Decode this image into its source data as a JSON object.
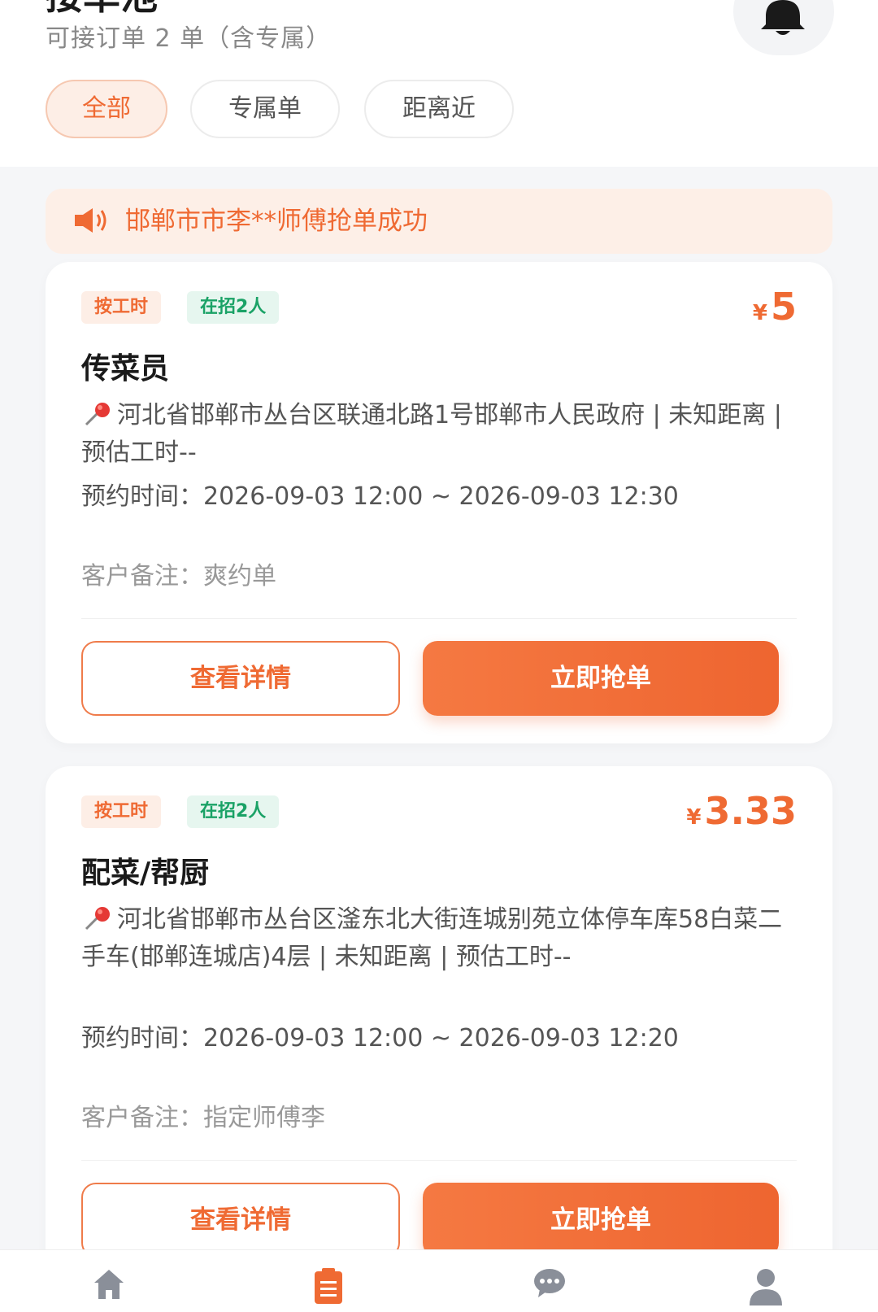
{
  "header": {
    "title": "接单池",
    "subtitle": "可接订单 2 单（含专属）",
    "filters": [
      {
        "label": "全部",
        "active": true
      },
      {
        "label": "专属单",
        "active": false
      },
      {
        "label": "距离近",
        "active": false
      }
    ],
    "bell_icon": "bell-icon"
  },
  "banner": {
    "icon": "speaker-icon",
    "text": "邯郸市市李**师傅抢单成功"
  },
  "orders": [
    {
      "tags": [
        "按工时",
        "在招2人"
      ],
      "price_symbol": "¥",
      "price": "5",
      "title": "传菜员",
      "address": "河北省邯郸市丛台区联通北路1号邯郸市人民政府 | 未知距离 | 预估工时--",
      "time": "预约时间：2026-09-03 12:00 ~ 2026-09-03 12:30",
      "note": "客户备注：爽约单",
      "detail_label": "查看详情",
      "grab_label": "立即抢单"
    },
    {
      "tags": [
        "按工时",
        "在招2人"
      ],
      "price_symbol": "¥",
      "price": "3.33",
      "title": "配菜/帮厨",
      "address": "河北省邯郸市丛台区滏东北大街连城别苑立体停车库58白菜二手车(邯郸连城店)4层 | 未知距离 | 预估工时--",
      "time": "预约时间：2026-09-03 12:00 ~ 2026-09-03 12:20",
      "note": "客户备注：指定师傅李",
      "detail_label": "查看详情",
      "grab_label": "立即抢单"
    }
  ],
  "tabbar": {
    "items": [
      {
        "icon": "home-icon",
        "active": false
      },
      {
        "icon": "orders-icon",
        "active": true
      },
      {
        "icon": "message-icon",
        "active": false
      },
      {
        "icon": "profile-icon",
        "active": false
      }
    ]
  },
  "colors": {
    "accent": "#ef6a33",
    "accent_light": "#fdeee6",
    "green": "#1aa266",
    "icon_gray": "#8a8f99",
    "background": "#f5f6f8"
  }
}
